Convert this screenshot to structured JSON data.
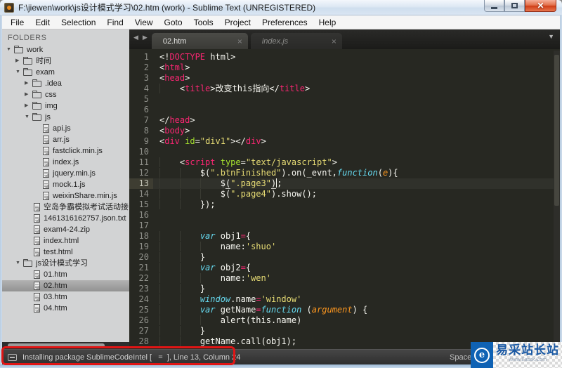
{
  "window": {
    "title": "F:\\jiewen\\work\\js设计模式学习\\02.htm (work) - Sublime Text (UNREGISTERED)"
  },
  "icons": {
    "close_glyph": "✕",
    "scroll_left": "◀",
    "scroll_right": "▶",
    "overflow": "▼",
    "tab_close": "×",
    "expanded": "▼",
    "collapsed": "▶"
  },
  "menu": {
    "items": [
      "File",
      "Edit",
      "Selection",
      "Find",
      "View",
      "Goto",
      "Tools",
      "Project",
      "Preferences",
      "Help"
    ]
  },
  "sidebar": {
    "header": "FOLDERS",
    "tree": [
      {
        "label": "work",
        "depth": 0,
        "kind": "folder",
        "state": "open"
      },
      {
        "label": "时间",
        "depth": 1,
        "kind": "folder",
        "state": "closed"
      },
      {
        "label": "exam",
        "depth": 1,
        "kind": "folder",
        "state": "open"
      },
      {
        "label": ".idea",
        "depth": 2,
        "kind": "folder",
        "state": "closed"
      },
      {
        "label": "css",
        "depth": 2,
        "kind": "folder",
        "state": "closed"
      },
      {
        "label": "img",
        "depth": 2,
        "kind": "folder",
        "state": "closed"
      },
      {
        "label": "js",
        "depth": 2,
        "kind": "folder",
        "state": "open"
      },
      {
        "label": "api.js",
        "depth": 3,
        "kind": "file"
      },
      {
        "label": "arr.js",
        "depth": 3,
        "kind": "file"
      },
      {
        "label": "fastclick.min.js",
        "depth": 3,
        "kind": "file"
      },
      {
        "label": "index.js",
        "depth": 3,
        "kind": "file"
      },
      {
        "label": "jquery.min.js",
        "depth": 3,
        "kind": "file"
      },
      {
        "label": "mock.1.js",
        "depth": 3,
        "kind": "file"
      },
      {
        "label": "weixinShare.min.js",
        "depth": 3,
        "kind": "file"
      },
      {
        "label": "空岛争霸模拟考试活动接口",
        "depth": 2,
        "kind": "file"
      },
      {
        "label": "1461316162757.json.txt",
        "depth": 2,
        "kind": "file"
      },
      {
        "label": "exam4-24.zip",
        "depth": 2,
        "kind": "file"
      },
      {
        "label": "index.html",
        "depth": 2,
        "kind": "file"
      },
      {
        "label": "test.html",
        "depth": 2,
        "kind": "file"
      },
      {
        "label": "js设计模式学习",
        "depth": 1,
        "kind": "folder",
        "state": "open"
      },
      {
        "label": "01.htm",
        "depth": 2,
        "kind": "file"
      },
      {
        "label": "02.htm",
        "depth": 2,
        "kind": "file",
        "selected": true
      },
      {
        "label": "03.htm",
        "depth": 2,
        "kind": "file"
      },
      {
        "label": "04.htm",
        "depth": 2,
        "kind": "file"
      }
    ]
  },
  "tabs": [
    {
      "label": "02.htm",
      "active": true
    },
    {
      "label": "index.js",
      "active": false
    }
  ],
  "editor": {
    "lines": [
      {
        "n": 1,
        "t": [
          [
            "w",
            "<!"
          ],
          [
            "p",
            "DOCTYPE"
          ],
          [
            "w",
            " html>"
          ]
        ]
      },
      {
        "n": 2,
        "t": [
          [
            "w",
            "<"
          ],
          [
            "p",
            "html"
          ],
          [
            "w",
            ">"
          ]
        ]
      },
      {
        "n": 3,
        "t": [
          [
            "w",
            "<"
          ],
          [
            "p",
            "head"
          ],
          [
            "w",
            ">"
          ]
        ]
      },
      {
        "n": 4,
        "t": [
          [
            "w",
            "    <"
          ],
          [
            "p",
            "title"
          ],
          [
            "w",
            ">改变this指向</"
          ],
          [
            "p",
            "title"
          ],
          [
            "w",
            ">"
          ]
        ]
      },
      {
        "n": 5,
        "t": []
      },
      {
        "n": 6,
        "t": []
      },
      {
        "n": 7,
        "t": [
          [
            "w",
            "</"
          ],
          [
            "p",
            "head"
          ],
          [
            "w",
            ">"
          ]
        ]
      },
      {
        "n": 8,
        "t": [
          [
            "w",
            "<"
          ],
          [
            "p",
            "body"
          ],
          [
            "w",
            ">"
          ]
        ]
      },
      {
        "n": 9,
        "t": [
          [
            "w",
            "<"
          ],
          [
            "p",
            "div"
          ],
          [
            "w",
            " "
          ],
          [
            "g",
            "id"
          ],
          [
            "w",
            "="
          ],
          [
            "y",
            "\"div1\""
          ],
          [
            "w",
            "></"
          ],
          [
            "p",
            "div"
          ],
          [
            "w",
            ">"
          ]
        ]
      },
      {
        "n": 10,
        "t": []
      },
      {
        "n": 11,
        "t": [
          [
            "w",
            "    <"
          ],
          [
            "p",
            "script"
          ],
          [
            "w",
            " "
          ],
          [
            "g",
            "type"
          ],
          [
            "w",
            "="
          ],
          [
            "y",
            "\"text/javascript\""
          ],
          [
            "w",
            ">"
          ]
        ]
      },
      {
        "n": 12,
        "t": [
          [
            "w",
            "        $("
          ],
          [
            "y",
            "\".btnFinished\""
          ],
          [
            "w",
            ").on(_evnt,"
          ],
          [
            "b",
            "function"
          ],
          [
            "w",
            "("
          ],
          [
            "o",
            "e"
          ],
          [
            "w",
            "){"
          ]
        ]
      },
      {
        "n": 13,
        "cur": true,
        "t": [
          [
            "w",
            "            $"
          ],
          [
            "u",
            "("
          ],
          [
            "y",
            "\".page3\""
          ],
          [
            "u",
            ")"
          ],
          [
            "c",
            ""
          ],
          [
            "w",
            ";"
          ]
        ]
      },
      {
        "n": 14,
        "t": [
          [
            "w",
            "            $("
          ],
          [
            "y",
            "\".page4\""
          ],
          [
            "w",
            ").show();"
          ]
        ]
      },
      {
        "n": 15,
        "t": [
          [
            "w",
            "        });"
          ]
        ]
      },
      {
        "n": 16,
        "t": []
      },
      {
        "n": 17,
        "t": []
      },
      {
        "n": 18,
        "t": [
          [
            "w",
            "        "
          ],
          [
            "b",
            "var"
          ],
          [
            "w",
            " obj1"
          ],
          [
            "p",
            "="
          ],
          [
            "w",
            "{"
          ]
        ]
      },
      {
        "n": 19,
        "t": [
          [
            "w",
            "            name:"
          ],
          [
            "y",
            "'shuo'"
          ]
        ]
      },
      {
        "n": 20,
        "t": [
          [
            "w",
            "        }"
          ]
        ]
      },
      {
        "n": 21,
        "t": [
          [
            "w",
            "        "
          ],
          [
            "b",
            "var"
          ],
          [
            "w",
            " obj2"
          ],
          [
            "p",
            "="
          ],
          [
            "w",
            "{"
          ]
        ]
      },
      {
        "n": 22,
        "t": [
          [
            "w",
            "            name:"
          ],
          [
            "y",
            "'wen'"
          ]
        ]
      },
      {
        "n": 23,
        "t": [
          [
            "w",
            "        }"
          ]
        ]
      },
      {
        "n": 24,
        "t": [
          [
            "w",
            "        "
          ],
          [
            "b",
            "window"
          ],
          [
            "w",
            ".name"
          ],
          [
            "p",
            "="
          ],
          [
            "y",
            "'window'"
          ]
        ]
      },
      {
        "n": 25,
        "t": [
          [
            "w",
            "        "
          ],
          [
            "b",
            "var"
          ],
          [
            "w",
            " getName"
          ],
          [
            "p",
            "="
          ],
          [
            "b",
            "function"
          ],
          [
            "w",
            " ("
          ],
          [
            "o",
            "argument"
          ],
          [
            "w",
            ") {"
          ]
        ]
      },
      {
        "n": 26,
        "t": [
          [
            "w",
            "            alert(this.name)"
          ]
        ]
      },
      {
        "n": 27,
        "t": [
          [
            "w",
            "        }"
          ]
        ]
      },
      {
        "n": 28,
        "t": [
          [
            "w",
            "        getName.call(obj1);"
          ]
        ]
      }
    ]
  },
  "status": {
    "left": "Installing package SublimeCodeIntel [   =  ], Line 13, Column 24",
    "right": "Spaces: 4"
  },
  "watermark": {
    "icon_letter": "e",
    "title": "易采站长站",
    "subtitle": "Www.Easck.Com"
  },
  "colors": {
    "editor_bg": "#272822",
    "tag_pink": "#f92672",
    "attr_green": "#a6e22e",
    "string_yellow": "#e6db74",
    "keyword_blue": "#66d9ef",
    "param_orange": "#fd971f",
    "annotation_red": "#e01515",
    "watermark_blue": "#0f62b4"
  }
}
